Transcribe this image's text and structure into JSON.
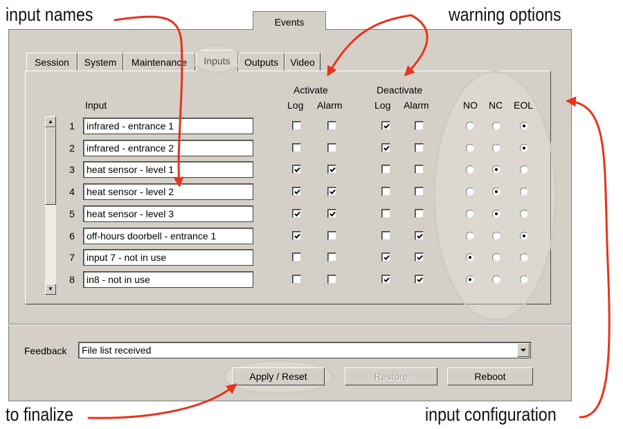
{
  "annotations": {
    "input_names": "input names",
    "warning_options": "warning options",
    "to_finalize": "to finalize",
    "input_configuration": "input configuration"
  },
  "window": {
    "top_tab": "Events",
    "tabs": [
      "Session",
      "System",
      "Maintenance",
      "Inputs",
      "Outputs",
      "Video"
    ],
    "active_tab": "Inputs"
  },
  "table": {
    "input_header": "Input",
    "activate_header": "Activate",
    "deactivate_header": "Deactivate",
    "log_header": "Log",
    "alarm_header": "Alarm",
    "no_header": "NO",
    "nc_header": "NC",
    "eol_header": "EOL",
    "rows": [
      {
        "num": "1",
        "name": "infrared - entrance 1",
        "act_log": false,
        "act_alarm": false,
        "deact_log": true,
        "deact_alarm": false,
        "mode": "EOL"
      },
      {
        "num": "2",
        "name": "infrared - entrance 2",
        "act_log": false,
        "act_alarm": false,
        "deact_log": true,
        "deact_alarm": false,
        "mode": "EOL"
      },
      {
        "num": "3",
        "name": "heat sensor -  level 1",
        "act_log": true,
        "act_alarm": true,
        "deact_log": false,
        "deact_alarm": false,
        "mode": "NC"
      },
      {
        "num": "4",
        "name": "heat sensor -  level 2",
        "act_log": true,
        "act_alarm": true,
        "deact_log": false,
        "deact_alarm": false,
        "mode": "NC"
      },
      {
        "num": "5",
        "name": "heat sensor -  level 3",
        "act_log": true,
        "act_alarm": true,
        "deact_log": false,
        "deact_alarm": false,
        "mode": "NC"
      },
      {
        "num": "6",
        "name": "off-hours doorbell - entrance 1",
        "act_log": true,
        "act_alarm": false,
        "deact_log": false,
        "deact_alarm": true,
        "mode": "EOL"
      },
      {
        "num": "7",
        "name": "input 7 - not in use",
        "act_log": false,
        "act_alarm": false,
        "deact_log": true,
        "deact_alarm": true,
        "mode": "NO"
      },
      {
        "num": "8",
        "name": "in8 - not in use",
        "act_log": false,
        "act_alarm": false,
        "deact_log": true,
        "deact_alarm": true,
        "mode": "NO"
      }
    ]
  },
  "feedback": {
    "label": "Feedback",
    "value": "File list received"
  },
  "buttons": {
    "apply": "Apply / Reset",
    "restore": "Restore",
    "reboot": "Reboot"
  },
  "colors": {
    "window_bg": "#d4d0c8",
    "arrow": "#e8321c",
    "highlight": "#cfccbf"
  }
}
